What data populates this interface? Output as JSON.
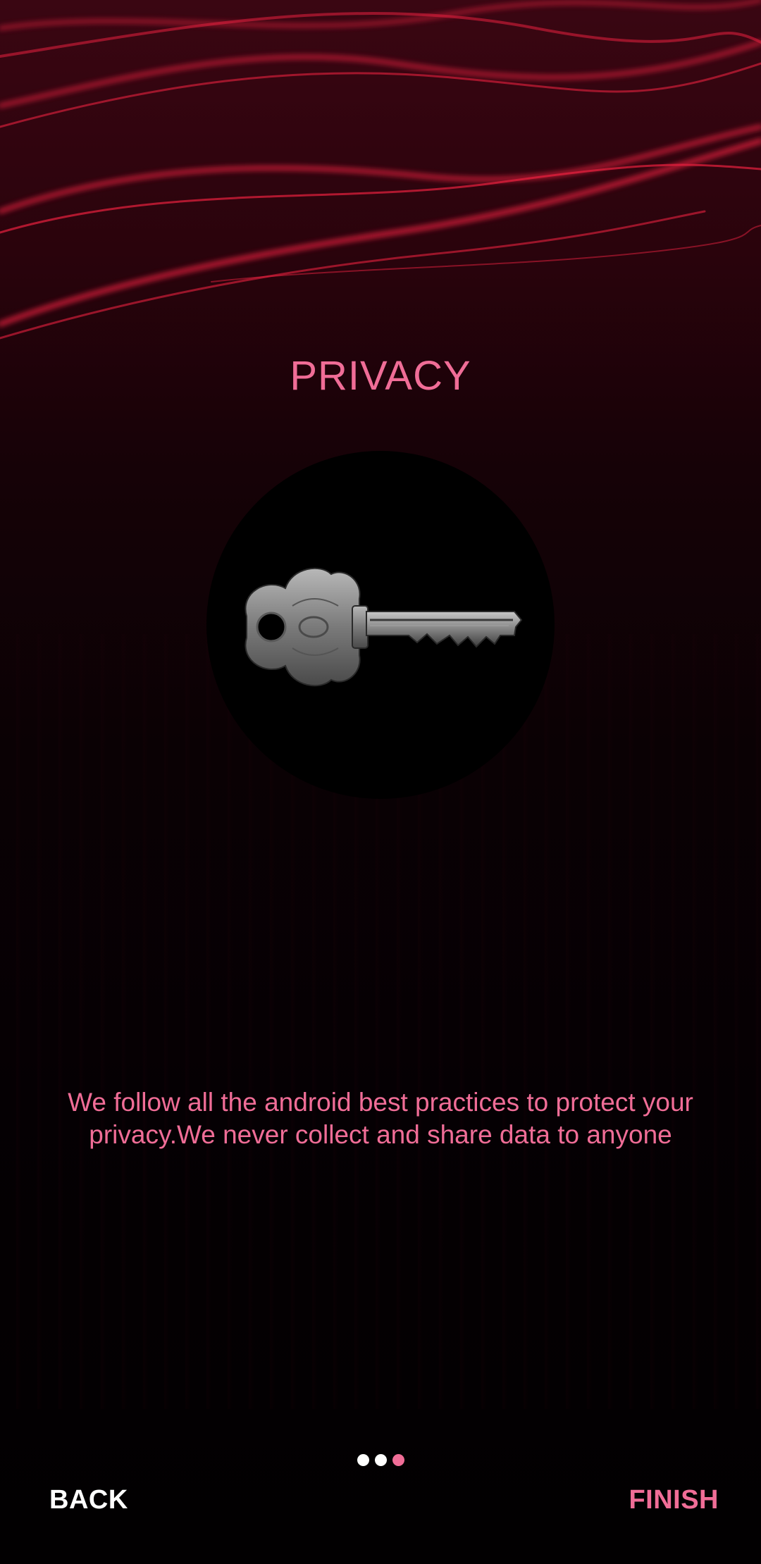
{
  "screen": {
    "title": "PRIVACY",
    "icon": "key-icon",
    "description": "We follow all the android best practices to protect your privacy.We never collect and share data to anyone"
  },
  "pager": {
    "total": 3,
    "current": 3
  },
  "nav": {
    "back_label": "BACK",
    "finish_label": "FINISH"
  },
  "colors": {
    "accent": "#f06d97",
    "background": "#0a0104",
    "streak": "#e8213f"
  }
}
